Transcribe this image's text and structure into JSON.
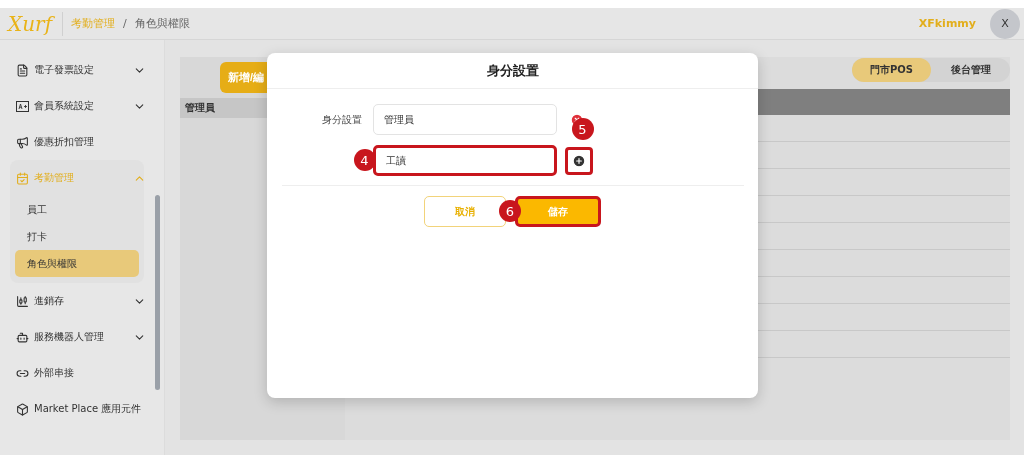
{
  "header": {
    "logo": "Xurf",
    "breadcrumb": [
      "考勤管理",
      "角色與權限"
    ],
    "separator": "/",
    "user": "XFkimmy",
    "avatar": "X"
  },
  "sidebar": {
    "items": [
      {
        "label": "電子發票設定",
        "expandable": true,
        "expanded": false
      },
      {
        "label": "會員系統設定",
        "expandable": true,
        "expanded": false
      },
      {
        "label": "優惠折扣管理",
        "expandable": false,
        "expanded": false
      },
      {
        "label": "考勤管理",
        "expandable": true,
        "expanded": true,
        "children": [
          {
            "label": "員工",
            "selected": false
          },
          {
            "label": "打卡",
            "selected": false
          },
          {
            "label": "角色與權限",
            "selected": true
          }
        ]
      },
      {
        "label": "進銷存",
        "expandable": true,
        "expanded": false
      },
      {
        "label": "服務機器人管理",
        "expandable": true,
        "expanded": false
      },
      {
        "label": "外部串接",
        "expandable": false,
        "expanded": false
      },
      {
        "label": "Market Place 應用元件",
        "expandable": false,
        "expanded": false
      }
    ]
  },
  "main": {
    "add_button": "新增/編",
    "roles": [
      {
        "label": "管理員",
        "selected": true
      }
    ],
    "tabs": [
      {
        "label": "門市POS",
        "selected": true
      },
      {
        "label": "後台管理",
        "selected": false
      }
    ]
  },
  "modal": {
    "title": "身分設置",
    "field_label": "身分設置",
    "rows": [
      {
        "value": "管理員",
        "kind": "remove"
      },
      {
        "value": "工讀",
        "kind": "add",
        "field_callout": "4",
        "action_callout": "5"
      }
    ],
    "buttons": [
      {
        "label": "取消",
        "kind": "secondary"
      },
      {
        "label": "儲存",
        "kind": "primary",
        "callout": "6"
      }
    ]
  }
}
